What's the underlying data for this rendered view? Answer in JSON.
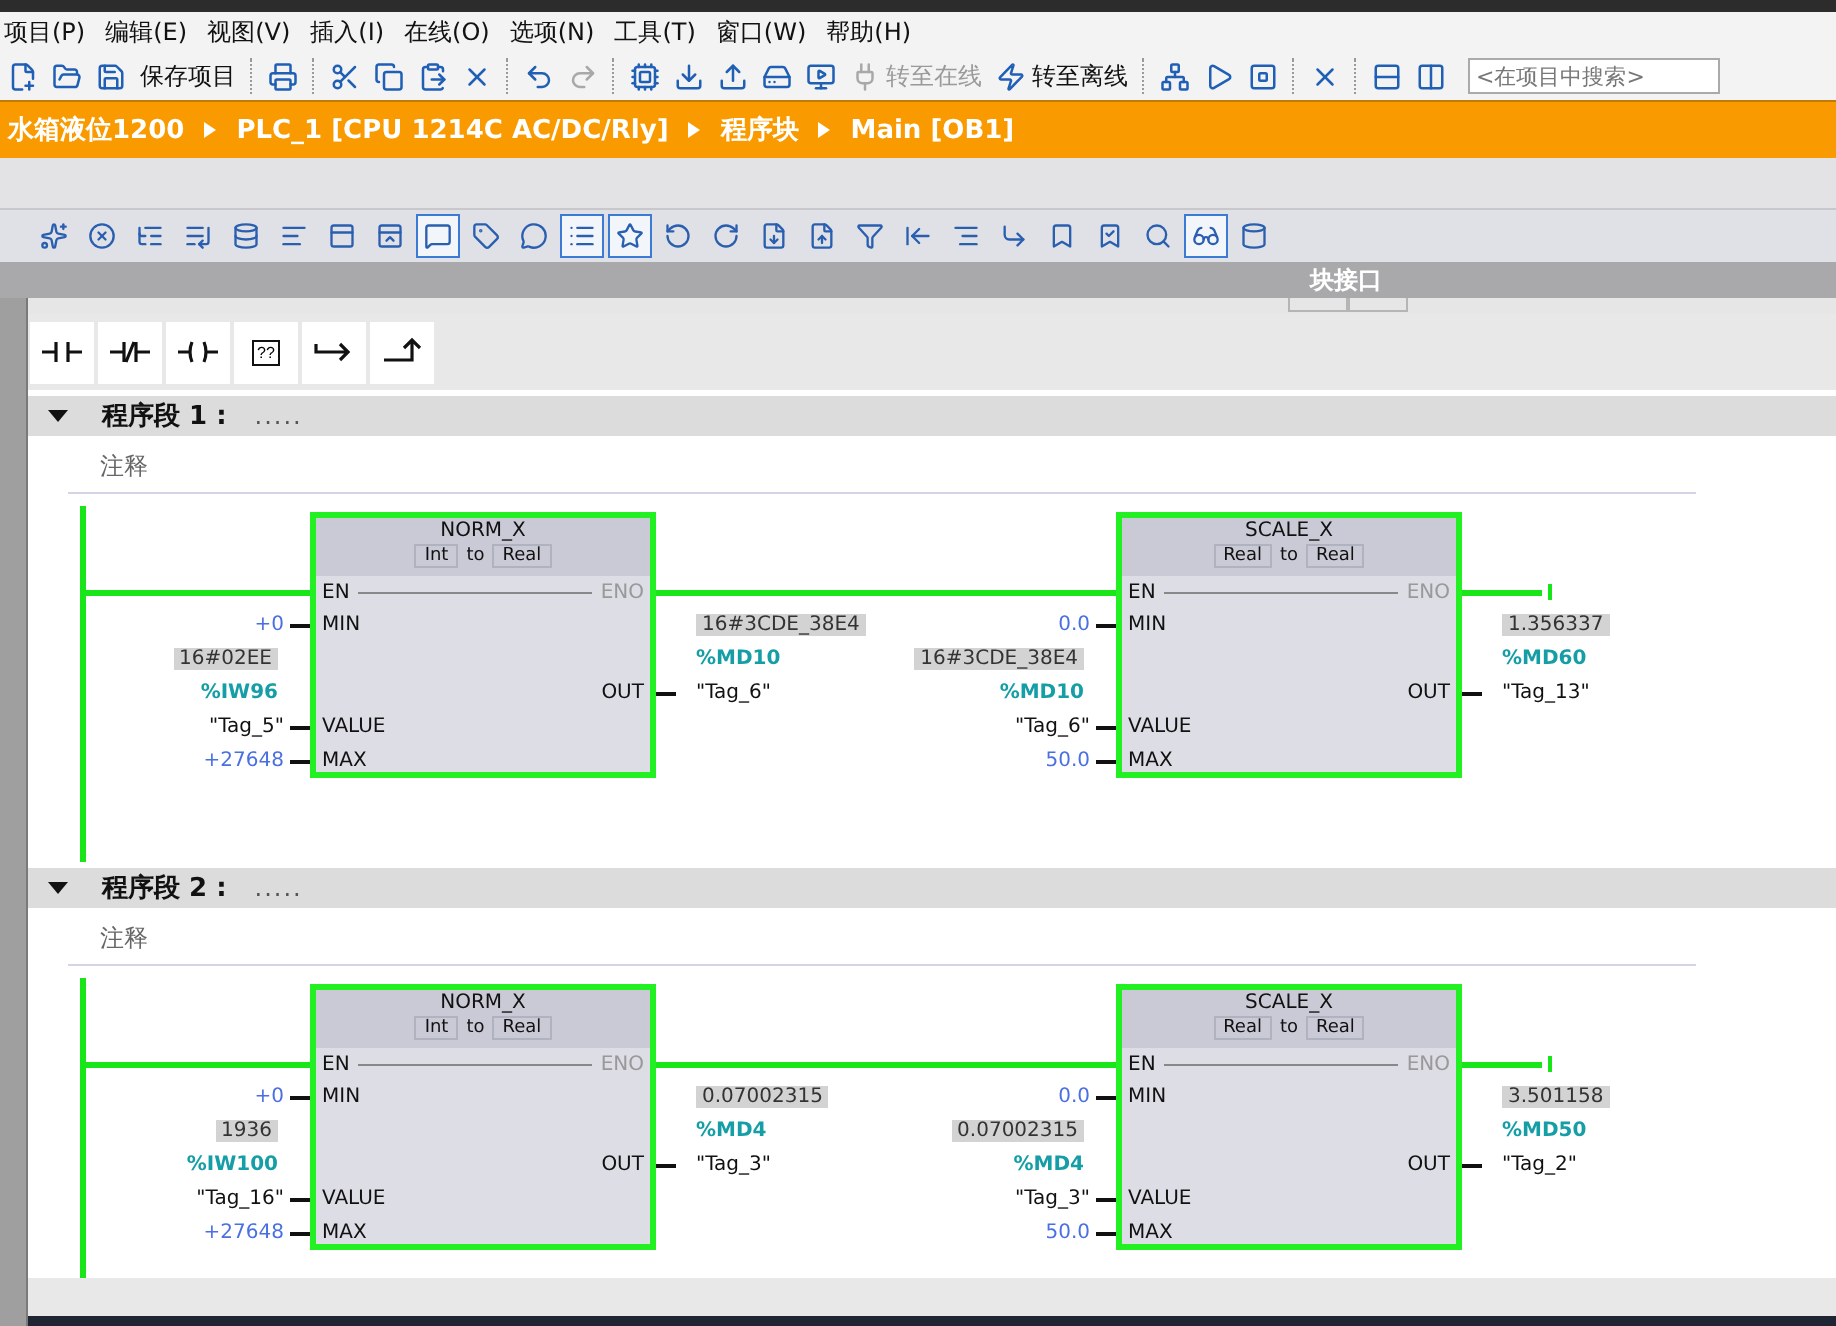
{
  "menu": [
    {
      "label": "项目(P)"
    },
    {
      "label": "编辑(E)"
    },
    {
      "label": "视图(V)"
    },
    {
      "label": "插入(I)"
    },
    {
      "label": "在线(O)"
    },
    {
      "label": "选项(N)"
    },
    {
      "label": "工具(T)"
    },
    {
      "label": "窗口(W)"
    },
    {
      "label": "帮助(H)"
    }
  ],
  "toolbar": {
    "items": [
      {
        "kind": "icon",
        "disabled": false
      },
      {
        "kind": "icon",
        "disabled": false
      },
      {
        "kind": "icon",
        "disabled": false
      },
      {
        "kind": "text",
        "label": "保存项目",
        "disabled": false
      },
      {
        "kind": "separator"
      },
      {
        "kind": "icon",
        "disabled": false
      },
      {
        "kind": "separator"
      },
      {
        "kind": "icon",
        "disabled": false
      },
      {
        "kind": "icon",
        "disabled": false
      },
      {
        "kind": "icon",
        "disabled": false
      },
      {
        "kind": "icon",
        "disabled": false
      },
      {
        "kind": "separator"
      },
      {
        "kind": "icon",
        "disabled": false
      },
      {
        "kind": "icon",
        "disabled": true
      },
      {
        "kind": "separator"
      },
      {
        "kind": "icon",
        "disabled": false
      },
      {
        "kind": "icon",
        "disabled": false
      },
      {
        "kind": "icon",
        "disabled": false
      },
      {
        "kind": "icon",
        "disabled": false
      },
      {
        "kind": "icon",
        "disabled": false
      },
      {
        "kind": "labeled",
        "label": "转至在线",
        "disabled": true
      },
      {
        "kind": "labeled",
        "label": "转至离线",
        "disabled": false
      },
      {
        "kind": "separator"
      },
      {
        "kind": "icon",
        "disabled": false
      },
      {
        "kind": "icon",
        "disabled": false
      },
      {
        "kind": "icon",
        "disabled": false
      },
      {
        "kind": "separator"
      },
      {
        "kind": "icon",
        "disabled": false
      },
      {
        "kind": "separator"
      },
      {
        "kind": "icon",
        "disabled": false
      },
      {
        "kind": "icon",
        "disabled": false
      }
    ],
    "search": {
      "placeholder": "<在项目中搜索>"
    }
  },
  "breadcrumb": [
    "水箱液位1200",
    "PLC_1 [CPU 1214C AC/DC/Rly]",
    "程序块",
    "Main [OB1]"
  ],
  "block_toolbar": {
    "tools": [
      {
        "selected": false
      },
      {
        "selected": false
      },
      {
        "selected": false
      },
      {
        "selected": false
      },
      {
        "selected": false
      },
      {
        "selected": false
      },
      {
        "selected": false
      },
      {
        "selected": false
      },
      {
        "selected": true
      },
      {
        "selected": false
      },
      {
        "selected": false
      },
      {
        "selected": true
      },
      {
        "selected": true
      },
      {
        "selected": false
      },
      {
        "selected": false
      },
      {
        "selected": false
      },
      {
        "selected": false
      },
      {
        "selected": false
      },
      {
        "selected": false
      },
      {
        "selected": false
      },
      {
        "selected": false
      },
      {
        "selected": false
      },
      {
        "selected": false
      },
      {
        "selected": false
      },
      {
        "selected": true
      },
      {
        "selected": false
      }
    ],
    "interface_label": "块接口"
  },
  "palette": [
    {
      "kind": "no-contact"
    },
    {
      "kind": "nc-contact"
    },
    {
      "kind": "coil"
    },
    {
      "kind": "empty-box",
      "label": "??"
    },
    {
      "kind": "jump"
    },
    {
      "kind": "branch"
    }
  ],
  "networks": [
    {
      "expanded": true,
      "title": "程序段 1 :",
      "dots": ".....",
      "comment": "注释",
      "blocks": [
        {
          "name": "NORM_X",
          "in_type": "Int",
          "to": "to",
          "out_type": "Real",
          "en": "EN",
          "eno": "ENO",
          "inputs": [
            {
              "pin": "MIN",
              "kind": "constant",
              "value": "+0"
            },
            {
              "pin": "VALUE",
              "kind": "tag",
              "monitor": "16#02EE",
              "address": "%IW96",
              "tag": "\"Tag_5\""
            },
            {
              "pin": "MAX",
              "kind": "constant",
              "value": "+27648"
            }
          ],
          "output": {
            "pin": "OUT",
            "monitor": "16#3CDE_38E4",
            "address": "%MD10",
            "tag": "\"Tag_6\""
          }
        },
        {
          "name": "SCALE_X",
          "in_type": "Real",
          "to": "to",
          "out_type": "Real",
          "en": "EN",
          "eno": "ENO",
          "inputs": [
            {
              "pin": "MIN",
              "kind": "constant",
              "value": "0.0"
            },
            {
              "pin": "VALUE",
              "kind": "tag",
              "monitor": "16#3CDE_38E4",
              "address": "%MD10",
              "tag": "\"Tag_6\""
            },
            {
              "pin": "MAX",
              "kind": "constant",
              "value": "50.0"
            }
          ],
          "output": {
            "pin": "OUT",
            "monitor": "1.356337",
            "address": "%MD60",
            "tag": "\"Tag_13\""
          }
        }
      ]
    },
    {
      "expanded": true,
      "title": "程序段 2 :",
      "dots": ".....",
      "comment": "注释",
      "blocks": [
        {
          "name": "NORM_X",
          "in_type": "Int",
          "to": "to",
          "out_type": "Real",
          "en": "EN",
          "eno": "ENO",
          "inputs": [
            {
              "pin": "MIN",
              "kind": "constant",
              "value": "+0"
            },
            {
              "pin": "VALUE",
              "kind": "tag",
              "monitor": "1936",
              "address": "%IW100",
              "tag": "\"Tag_16\""
            },
            {
              "pin": "MAX",
              "kind": "constant",
              "value": "+27648"
            }
          ],
          "output": {
            "pin": "OUT",
            "monitor": "0.07002315",
            "address": "%MD4",
            "tag": "\"Tag_3\""
          }
        },
        {
          "name": "SCALE_X",
          "in_type": "Real",
          "to": "to",
          "out_type": "Real",
          "en": "EN",
          "eno": "ENO",
          "inputs": [
            {
              "pin": "MIN",
              "kind": "constant",
              "value": "0.0"
            },
            {
              "pin": "VALUE",
              "kind": "tag",
              "monitor": "0.07002315",
              "address": "%MD4",
              "tag": "\"Tag_3\""
            },
            {
              "pin": "MAX",
              "kind": "constant",
              "value": "50.0"
            }
          ],
          "output": {
            "pin": "OUT",
            "monitor": "3.501158",
            "address": "%MD50",
            "tag": "\"Tag_2\""
          }
        }
      ]
    }
  ]
}
